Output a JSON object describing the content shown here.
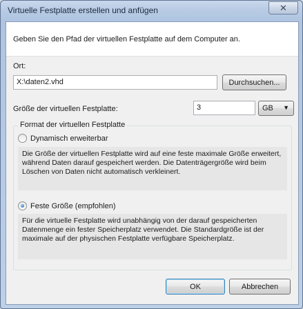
{
  "window": {
    "title": "Virtuelle Festplatte erstellen und anfügen",
    "close_symbol": "✕"
  },
  "instruction": "Geben Sie den Pfad der virtuellen Festplatte auf dem Computer an.",
  "location": {
    "label": "Ort:",
    "value": "X:\\daten2.vhd",
    "browse_label": "Durchsuchen..."
  },
  "size": {
    "label": "Größe der virtuellen Festplatte:",
    "value": "3",
    "unit": "GB",
    "dropdown_icon": "chevron-down-icon"
  },
  "format": {
    "group_title": "Format der virtuellen Festplatte",
    "options": [
      {
        "label": "Dynamisch erweiterbar",
        "selected": false,
        "description": "Die Größe der virtuellen Festplatte wird auf eine feste maximale Größe erweitert, während Daten darauf gespeichert werden. Die Datenträgergröße wird beim Löschen von Daten nicht automatisch verkleinert."
      },
      {
        "label": "Feste Größe (empfohlen)",
        "selected": true,
        "description": "Für die virtuelle Festplatte wird unabhängig von der darauf gespeicherten Datenmenge ein fester Speicherplatz verwendet. Die Standardgröße ist der maximale auf der physischen Festplatte verfügbare Speicherplatz."
      }
    ]
  },
  "buttons": {
    "ok": "OK",
    "cancel": "Abbrechen"
  }
}
